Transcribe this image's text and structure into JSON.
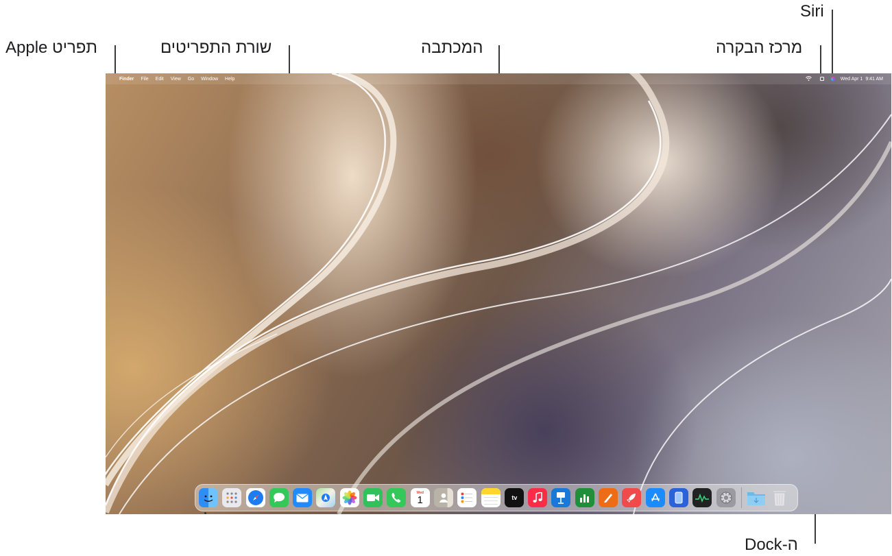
{
  "labels": {
    "apple_menu": "תפריט Apple",
    "menu_bar": "שורת התפריטים",
    "desktop": "המכתבה",
    "control_center": "מרכז הבקרה",
    "siri": "Siri",
    "dock": "ה-Dock"
  },
  "menubar": {
    "apple_icon": "",
    "app_name": "Finder",
    "items": [
      "File",
      "Edit",
      "View",
      "Go",
      "Window",
      "Help"
    ],
    "date": "Wed Apr 1",
    "time": "9:41 AM",
    "wifi_icon": "wifi-icon",
    "control_center_icon": "control-center-icon",
    "siri_icon": "siri-icon"
  },
  "dock": {
    "apps": [
      "Finder",
      "Launchpad",
      "Safari",
      "Messages",
      "Mail",
      "Maps",
      "Photos",
      "FaceTime",
      "Phone",
      "Calendar",
      "Contacts",
      "Reminders",
      "Notes",
      "TV",
      "Music",
      "Keynote",
      "Numbers",
      "Pages",
      "Rocket",
      "App Store",
      "Simulator",
      "Activity Monitor",
      "System Settings",
      "Downloads",
      "Trash"
    ],
    "calendar_month": "Wed",
    "calendar_day": "1",
    "tv_label": "tv"
  },
  "colors": {
    "finder": "#2f8df5",
    "safari": "#1e7cf2",
    "messages": "#34c759",
    "mail": "#1f8bff",
    "facetime": "#30c15a",
    "phone": "#34c759",
    "music": "#fa2d48",
    "keynote": "#1a78d8",
    "numbers": "#1f8f3a",
    "pages": "#ef6c17",
    "rocket": "#f04a4a",
    "appstore": "#1a8cff"
  }
}
